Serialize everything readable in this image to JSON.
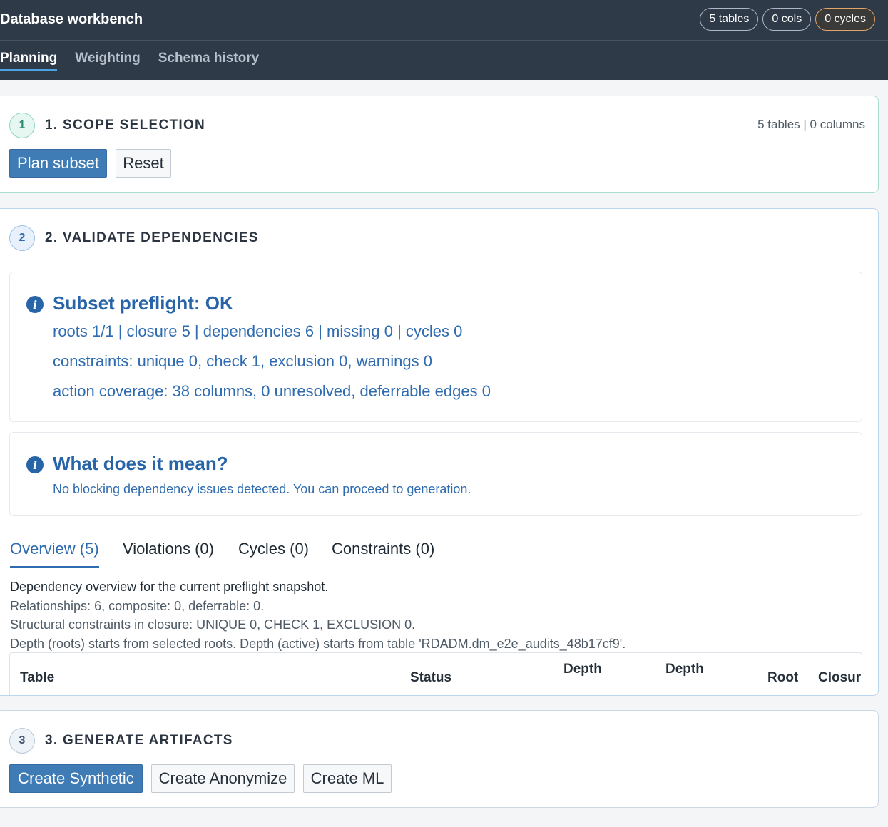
{
  "header": {
    "title": "Database workbench",
    "pills": {
      "tables": "5 tables",
      "cols": "0 cols",
      "cycles": "0 cycles"
    },
    "tabs": [
      "Planning",
      "Weighting",
      "Schema history"
    ],
    "active_tab": "Planning"
  },
  "scope": {
    "step": "1",
    "title": "1. SCOPE SELECTION",
    "stats": "5 tables | 0 columns",
    "plan_label": "Plan subset",
    "reset_label": "Reset"
  },
  "validate": {
    "step": "2",
    "title": "2. VALIDATE DEPENDENCIES",
    "preflight": {
      "title": "Subset preflight: OK",
      "lines": [
        "roots 1/1 | closure 5 | dependencies 6 | missing 0 | cycles 0",
        "constraints: unique 0, check 1, exclusion 0, warnings 0",
        "action coverage: 38 columns, 0 unresolved, deferrable edges 0"
      ]
    },
    "meaning": {
      "title": "What does it mean?",
      "text": "No blocking dependency issues detected. You can proceed to generation."
    },
    "tabs": [
      "Overview (5)",
      "Violations (0)",
      "Cycles (0)",
      "Constraints (0)"
    ],
    "active_tab": "Overview (5)",
    "description": [
      "Dependency overview for the current preflight snapshot.",
      "Relationships: 6, composite: 0, deferrable: 0.",
      "Structural constraints in closure: UNIQUE 0, CHECK 1, EXCLUSION 0.",
      "Depth (roots) starts from selected roots. Depth (active) starts from table 'RDADM.dm_e2e_audits_48b17cf9'."
    ],
    "table_headers": [
      "Table",
      "Status",
      "Depth",
      "Depth",
      "Root",
      "Closur"
    ]
  },
  "generate": {
    "step": "3",
    "title": "3. GENERATE ARTIFACTS",
    "buttons": [
      "Create Synthetic",
      "Create Anonymize",
      "Create ML"
    ]
  },
  "colors": {
    "header_bg": "#2e3a48",
    "accent_blue": "#2e6bb0",
    "primary_button": "#3f7cb5",
    "cycles_pill_border": "#e3a36b"
  },
  "icons": {
    "info": "info-circle-icon"
  }
}
